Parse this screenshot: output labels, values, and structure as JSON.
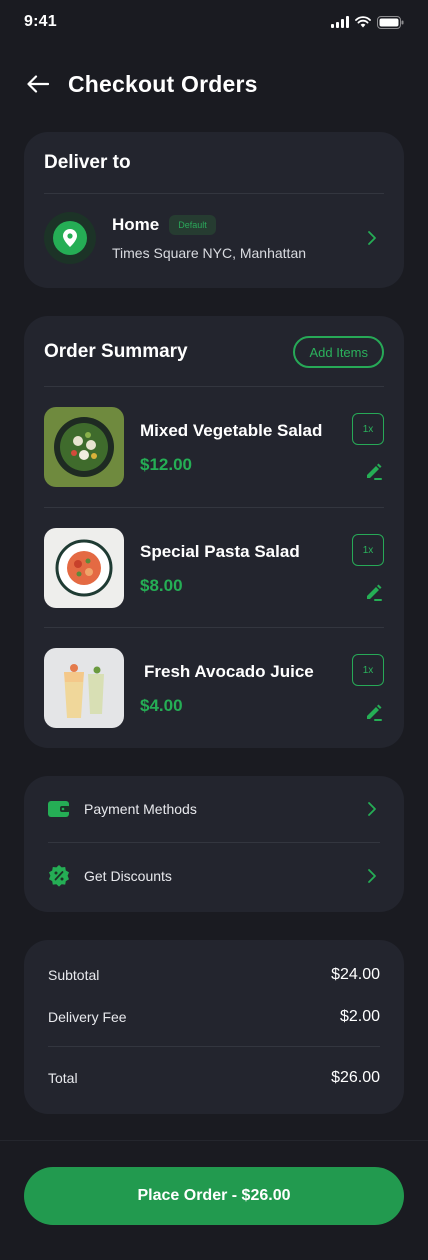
{
  "status_bar": {
    "time": "9:41"
  },
  "header": {
    "title": "Checkout Orders"
  },
  "deliver": {
    "title": "Deliver to",
    "address_name": "Home",
    "badge": "Default",
    "address_line": "Times Square NYC, Manhattan"
  },
  "order_summary": {
    "title": "Order Summary",
    "add_items_label": "Add Items",
    "items": [
      {
        "name": "Mixed Vegetable Salad",
        "price": "$12.00",
        "qty": "1x"
      },
      {
        "name": "Special Pasta Salad",
        "price": "$8.00",
        "qty": "1x"
      },
      {
        "name": "Fresh Avocado Juice",
        "price": "$4.00",
        "qty": "1x"
      }
    ]
  },
  "options": [
    {
      "label": "Payment Methods",
      "icon": "wallet-icon"
    },
    {
      "label": "Get Discounts",
      "icon": "discount-icon"
    }
  ],
  "totals": {
    "subtotal_label": "Subtotal",
    "subtotal_value": "$24.00",
    "fee_label": "Delivery Fee",
    "fee_value": "$2.00",
    "total_label": "Total",
    "total_value": "$26.00"
  },
  "cta": {
    "label": "Place Order - $26.00"
  },
  "colors": {
    "accent": "#25ae55",
    "background": "#1a1b21",
    "card": "#23252e"
  }
}
